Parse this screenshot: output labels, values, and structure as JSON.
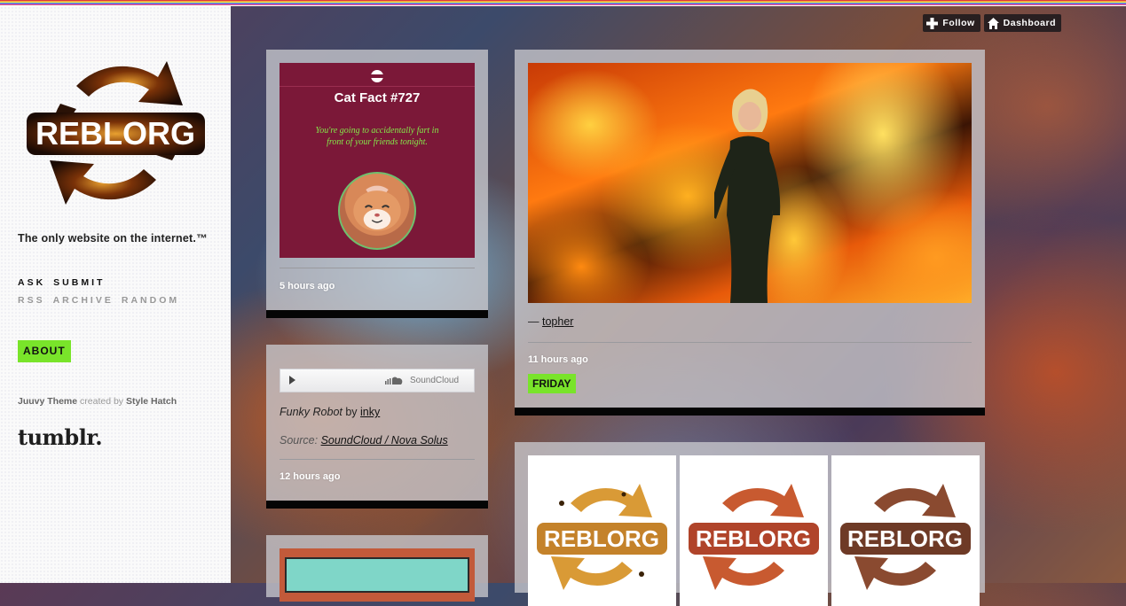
{
  "colors": {
    "accent": "#79e42a",
    "cat_card_bg": "#7b1838",
    "cat_fact_text": "#84e84a"
  },
  "sidebar": {
    "logo_text": "REBLORG",
    "tagline": "The only website on the internet.™",
    "nav_primary": [
      "ASK",
      "SUBMIT"
    ],
    "nav_secondary": [
      "RSS",
      "ARCHIVE",
      "RANDOM"
    ],
    "about_label": "ABOUT",
    "credit": {
      "theme": "Juuvy Theme",
      "middle": " created by ",
      "author": "Style Hatch"
    },
    "tumblr_logo": "tumblr."
  },
  "topbar": {
    "follow_label": "Follow",
    "dashboard_label": "Dashboard"
  },
  "posts": {
    "cat_fact": {
      "title": "Cat Fact #727",
      "fact": "You're going to accidentally fart in front of your friends tonight.",
      "time": "5 hours ago"
    },
    "audio": {
      "provider": "SoundCloud",
      "track": "Funky Robot",
      "by_word": " by ",
      "artist": "inky",
      "source_label": "Source: ",
      "source_link": "SoundCloud / Nova Solus",
      "time": "12 hours ago"
    },
    "gif": {
      "dash": "— ",
      "author": "topher",
      "time": "11 hours ago",
      "tag": "FRIDAY"
    },
    "photoset": {
      "tiles": [
        "REBLORG",
        "REBLORG",
        "REBLORG"
      ]
    }
  }
}
